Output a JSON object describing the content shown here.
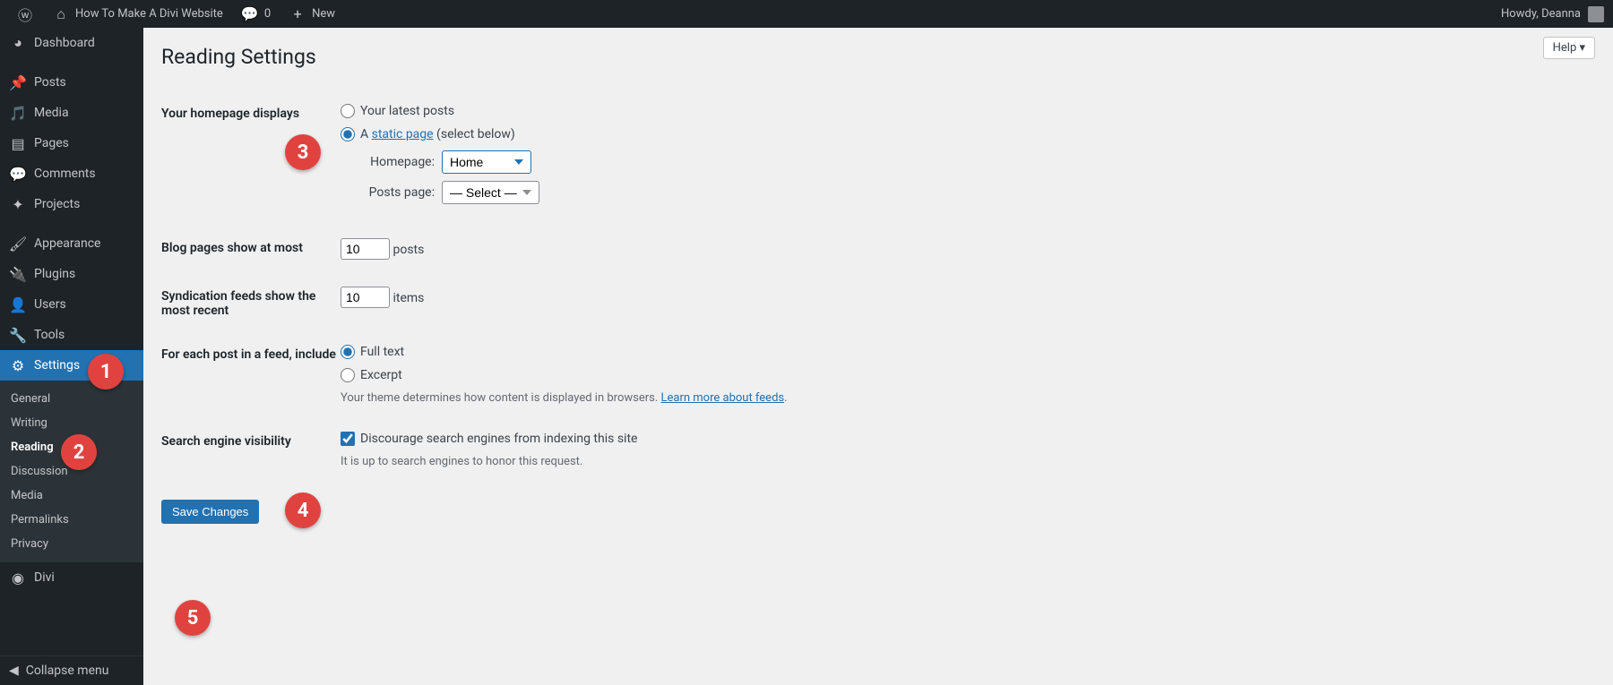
{
  "adminbar": {
    "site_title": "How To Make A Divi Website",
    "comments_count": "0",
    "new_label": "New",
    "greeting": "Howdy, Deanna"
  },
  "menu": {
    "dashboard": "Dashboard",
    "posts": "Posts",
    "media": "Media",
    "pages": "Pages",
    "comments": "Comments",
    "projects": "Projects",
    "appearance": "Appearance",
    "plugins": "Plugins",
    "users": "Users",
    "tools": "Tools",
    "settings": "Settings",
    "divi": "Divi",
    "collapse": "Collapse menu"
  },
  "submenu": {
    "general": "General",
    "writing": "Writing",
    "reading": "Reading",
    "discussion": "Discussion",
    "media": "Media",
    "permalinks": "Permalinks",
    "privacy": "Privacy"
  },
  "help": "Help ▾",
  "page": {
    "title": "Reading Settings",
    "homepage_displays_label": "Your homepage displays",
    "opt_latest": "Your latest posts",
    "opt_static_prefix": "A ",
    "opt_static_link": "static page",
    "opt_static_suffix": " (select below)",
    "homepage_label": "Homepage:",
    "homepage_value": "Home",
    "postspage_label": "Posts page:",
    "postspage_value": "— Select —",
    "blog_pages_label": "Blog pages show at most",
    "blog_pages_value": "10",
    "blog_pages_unit": "posts",
    "syndication_label": "Syndication feeds show the most recent",
    "syndication_value": "10",
    "syndication_unit": "items",
    "feed_include_label": "For each post in a feed, include",
    "feed_full": "Full text",
    "feed_excerpt": "Excerpt",
    "feed_desc_prefix": "Your theme determines how content is displayed in browsers. ",
    "feed_desc_link": "Learn more about feeds",
    "search_vis_label": "Search engine visibility",
    "search_vis_checkbox": "Discourage search engines from indexing this site",
    "search_vis_desc": "It is up to search engines to honor this request.",
    "save_button": "Save Changes"
  },
  "callouts": {
    "c1": "1",
    "c2": "2",
    "c3": "3",
    "c4": "4",
    "c5": "5"
  }
}
